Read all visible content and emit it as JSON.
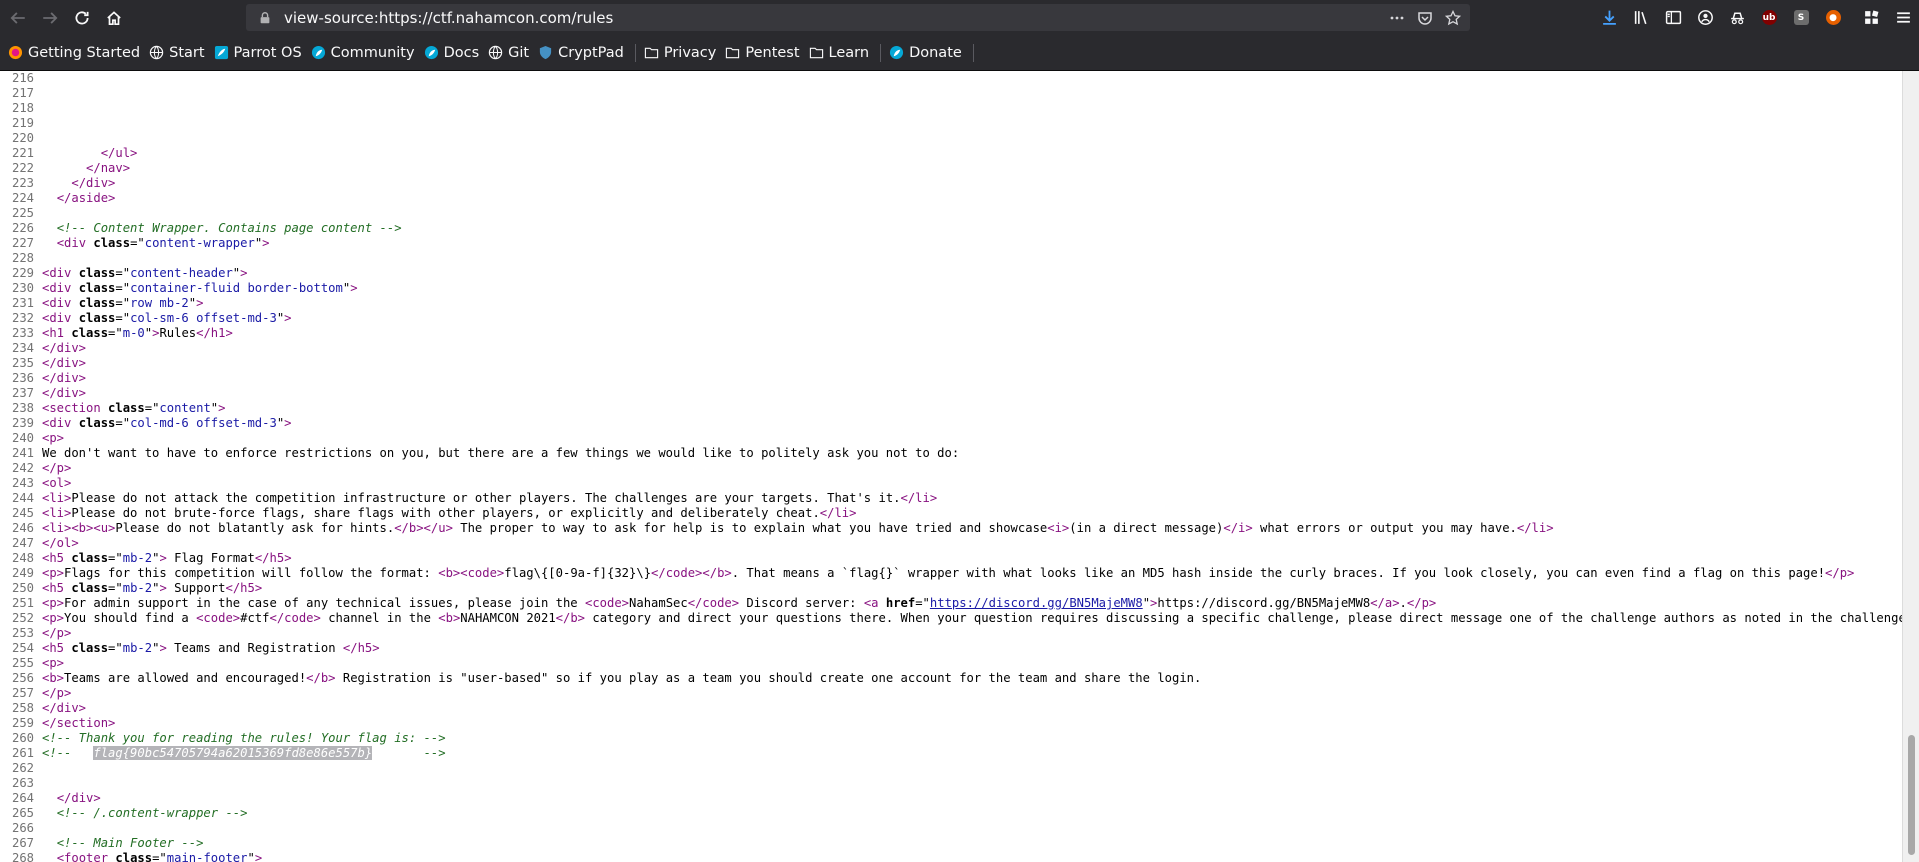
{
  "browser": {
    "url": "view-source:https://ctf.nahamcon.com/rules",
    "bookmarks": [
      {
        "label": "Getting Started",
        "icon": "firefox-icon"
      },
      {
        "label": "Start",
        "icon": "globe-icon"
      },
      {
        "label": "Parrot OS",
        "icon": "parrot-icon"
      },
      {
        "label": "Community",
        "icon": "parrot-community-icon"
      },
      {
        "label": "Docs",
        "icon": "parrot-docs-icon"
      },
      {
        "label": "Git",
        "icon": "globe-icon"
      },
      {
        "label": "CryptPad",
        "icon": "cryptpad-icon"
      },
      {
        "label": "Privacy",
        "icon": "folder-icon"
      },
      {
        "label": "Pentest",
        "icon": "folder-icon"
      },
      {
        "label": "Learn",
        "icon": "folder-icon"
      },
      {
        "label": "Donate",
        "icon": "parrot-donate-icon"
      }
    ]
  },
  "source": {
    "lines": [
      {
        "n": "216",
        "segs": []
      },
      {
        "n": "217",
        "segs": []
      },
      {
        "n": "218",
        "segs": []
      },
      {
        "n": "219",
        "segs": []
      },
      {
        "n": "220",
        "segs": []
      },
      {
        "n": "221",
        "segs": [
          {
            "t": "        "
          },
          {
            "c": "tag",
            "t": "</ul>"
          }
        ]
      },
      {
        "n": "222",
        "segs": [
          {
            "t": "      "
          },
          {
            "c": "tag",
            "t": "</nav>"
          }
        ]
      },
      {
        "n": "223",
        "segs": [
          {
            "t": "    "
          },
          {
            "c": "tag",
            "t": "</div>"
          }
        ]
      },
      {
        "n": "224",
        "segs": [
          {
            "t": "  "
          },
          {
            "c": "tag",
            "t": "</aside>"
          }
        ]
      },
      {
        "n": "225",
        "segs": []
      },
      {
        "n": "226",
        "segs": [
          {
            "t": "  "
          },
          {
            "c": "comment",
            "t": "<!-- Content Wrapper. Contains page content -->"
          }
        ]
      },
      {
        "n": "227",
        "segs": [
          {
            "t": "  "
          },
          {
            "c": "tag",
            "t": "<div "
          },
          {
            "c": "attr",
            "t": "class"
          },
          {
            "t": "=\""
          },
          {
            "c": "val",
            "t": "content-wrapper"
          },
          {
            "t": "\""
          },
          {
            "c": "tag",
            "t": ">"
          }
        ]
      },
      {
        "n": "228",
        "segs": []
      },
      {
        "n": "229",
        "segs": [
          {
            "c": "tag",
            "t": "<div "
          },
          {
            "c": "attr",
            "t": "class"
          },
          {
            "t": "=\""
          },
          {
            "c": "val",
            "t": "content-header"
          },
          {
            "t": "\""
          },
          {
            "c": "tag",
            "t": ">"
          }
        ]
      },
      {
        "n": "230",
        "segs": [
          {
            "c": "tag",
            "t": "<div "
          },
          {
            "c": "attr",
            "t": "class"
          },
          {
            "t": "=\""
          },
          {
            "c": "val",
            "t": "container-fluid border-bottom"
          },
          {
            "t": "\""
          },
          {
            "c": "tag",
            "t": ">"
          }
        ]
      },
      {
        "n": "231",
        "segs": [
          {
            "c": "tag",
            "t": "<div "
          },
          {
            "c": "attr",
            "t": "class"
          },
          {
            "t": "=\""
          },
          {
            "c": "val",
            "t": "row mb-2"
          },
          {
            "t": "\""
          },
          {
            "c": "tag",
            "t": ">"
          }
        ]
      },
      {
        "n": "232",
        "segs": [
          {
            "c": "tag",
            "t": "<div "
          },
          {
            "c": "attr",
            "t": "class"
          },
          {
            "t": "=\""
          },
          {
            "c": "val",
            "t": "col-sm-6 offset-md-3"
          },
          {
            "t": "\""
          },
          {
            "c": "tag",
            "t": ">"
          }
        ]
      },
      {
        "n": "233",
        "segs": [
          {
            "c": "tag",
            "t": "<h1 "
          },
          {
            "c": "attr",
            "t": "class"
          },
          {
            "t": "=\""
          },
          {
            "c": "val",
            "t": "m-0"
          },
          {
            "t": "\""
          },
          {
            "c": "tag",
            "t": ">"
          },
          {
            "t": "Rules"
          },
          {
            "c": "tag",
            "t": "</h1>"
          }
        ]
      },
      {
        "n": "234",
        "segs": [
          {
            "c": "tag",
            "t": "</div>"
          }
        ]
      },
      {
        "n": "235",
        "segs": [
          {
            "c": "tag",
            "t": "</div>"
          }
        ]
      },
      {
        "n": "236",
        "segs": [
          {
            "c": "tag",
            "t": "</div>"
          }
        ]
      },
      {
        "n": "237",
        "segs": [
          {
            "c": "tag",
            "t": "</div>"
          }
        ]
      },
      {
        "n": "238",
        "segs": [
          {
            "c": "tag",
            "t": "<section "
          },
          {
            "c": "attr",
            "t": "class"
          },
          {
            "t": "=\""
          },
          {
            "c": "val",
            "t": "content"
          },
          {
            "t": "\""
          },
          {
            "c": "tag",
            "t": ">"
          }
        ]
      },
      {
        "n": "239",
        "segs": [
          {
            "c": "tag",
            "t": "<div "
          },
          {
            "c": "attr",
            "t": "class"
          },
          {
            "t": "=\""
          },
          {
            "c": "val",
            "t": "col-md-6 offset-md-3"
          },
          {
            "t": "\""
          },
          {
            "c": "tag",
            "t": ">"
          }
        ]
      },
      {
        "n": "240",
        "segs": [
          {
            "c": "tag",
            "t": "<p>"
          }
        ]
      },
      {
        "n": "241",
        "segs": [
          {
            "t": "We don't want to have to enforce restrictions on you, but there are a few things we would like to politely ask you not to do:"
          }
        ]
      },
      {
        "n": "242",
        "segs": [
          {
            "c": "tag",
            "t": "</p>"
          }
        ]
      },
      {
        "n": "243",
        "segs": [
          {
            "c": "tag",
            "t": "<ol>"
          }
        ]
      },
      {
        "n": "244",
        "segs": [
          {
            "c": "tag",
            "t": "<li>"
          },
          {
            "t": "Please do not attack the competition infrastructure or other players. The challenges are your targets. That's it."
          },
          {
            "c": "tag",
            "t": "</li>"
          }
        ]
      },
      {
        "n": "245",
        "segs": [
          {
            "c": "tag",
            "t": "<li>"
          },
          {
            "t": "Please do not brute-force flags, share flags with other players, or explicitly and deliberately cheat."
          },
          {
            "c": "tag",
            "t": "</li>"
          }
        ]
      },
      {
        "n": "246",
        "segs": [
          {
            "c": "tag",
            "t": "<li><b><u>"
          },
          {
            "t": "Please do not blatantly ask for hints."
          },
          {
            "c": "tag",
            "t": "</b></u>"
          },
          {
            "t": " The proper to way to ask for help is to explain what you have tried and showcase"
          },
          {
            "c": "tag",
            "t": "<i>"
          },
          {
            "t": "(in a direct message)"
          },
          {
            "c": "tag",
            "t": "</i>"
          },
          {
            "t": " what errors or output you may have."
          },
          {
            "c": "tag",
            "t": "</li>"
          }
        ]
      },
      {
        "n": "247",
        "segs": [
          {
            "c": "tag",
            "t": "</ol>"
          }
        ]
      },
      {
        "n": "248",
        "segs": [
          {
            "c": "tag",
            "t": "<h5 "
          },
          {
            "c": "attr",
            "t": "class"
          },
          {
            "t": "=\""
          },
          {
            "c": "val",
            "t": "mb-2"
          },
          {
            "t": "\""
          },
          {
            "c": "tag",
            "t": ">"
          },
          {
            "t": " Flag Format"
          },
          {
            "c": "tag",
            "t": "</h5>"
          }
        ]
      },
      {
        "n": "249",
        "segs": [
          {
            "c": "tag",
            "t": "<p>"
          },
          {
            "t": "Flags for this competition will follow the format: "
          },
          {
            "c": "tag",
            "t": "<b><code>"
          },
          {
            "t": "flag\\{[0-9a-f]{32}\\}"
          },
          {
            "c": "tag",
            "t": "</code></b>"
          },
          {
            "t": ". That means a `flag{}` wrapper with what looks like an MD5 hash inside the curly braces. If you look closely, you can even find a flag on this page!"
          },
          {
            "c": "tag",
            "t": "</p>"
          }
        ]
      },
      {
        "n": "250",
        "segs": [
          {
            "c": "tag",
            "t": "<h5 "
          },
          {
            "c": "attr",
            "t": "class"
          },
          {
            "t": "=\""
          },
          {
            "c": "val",
            "t": "mb-2"
          },
          {
            "t": "\""
          },
          {
            "c": "tag",
            "t": ">"
          },
          {
            "t": " Support"
          },
          {
            "c": "tag",
            "t": "</h5>"
          }
        ]
      },
      {
        "n": "251",
        "segs": [
          {
            "c": "tag",
            "t": "<p>"
          },
          {
            "t": "For admin support in the case of any technical issues, please join the "
          },
          {
            "c": "tag",
            "t": "<code>"
          },
          {
            "t": "NahamSec"
          },
          {
            "c": "tag",
            "t": "</code>"
          },
          {
            "t": " Discord server: "
          },
          {
            "c": "tag",
            "t": "<a "
          },
          {
            "c": "attr",
            "t": "href"
          },
          {
            "t": "=\""
          },
          {
            "c": "link",
            "t": "https://discord.gg/BN5MajeMW8"
          },
          {
            "t": "\""
          },
          {
            "c": "tag",
            "t": ">"
          },
          {
            "t": "https://discord.gg/BN5MajeMW8"
          },
          {
            "c": "tag",
            "t": "</a>"
          },
          {
            "t": "."
          },
          {
            "c": "tag",
            "t": "</p>"
          }
        ]
      },
      {
        "n": "252",
        "segs": [
          {
            "c": "tag",
            "t": "<p>"
          },
          {
            "t": "You should find a "
          },
          {
            "c": "tag",
            "t": "<code>"
          },
          {
            "t": "#ctf"
          },
          {
            "c": "tag",
            "t": "</code>"
          },
          {
            "t": " channel in the "
          },
          {
            "c": "tag",
            "t": "<b>"
          },
          {
            "t": "NAHAMCON 2021"
          },
          {
            "c": "tag",
            "t": "</b>"
          },
          {
            "t": " category and direct your questions there. When your question requires discussing a specific challenge, please direct message one of the challenge authors as noted in the challenge desc"
          }
        ]
      },
      {
        "n": "253",
        "segs": [
          {
            "c": "tag",
            "t": "</p>"
          }
        ]
      },
      {
        "n": "254",
        "segs": [
          {
            "c": "tag",
            "t": "<h5 "
          },
          {
            "c": "attr",
            "t": "class"
          },
          {
            "t": "=\""
          },
          {
            "c": "val",
            "t": "mb-2"
          },
          {
            "t": "\""
          },
          {
            "c": "tag",
            "t": ">"
          },
          {
            "t": " Teams and Registration "
          },
          {
            "c": "tag",
            "t": "</h5>"
          }
        ]
      },
      {
        "n": "255",
        "segs": [
          {
            "c": "tag",
            "t": "<p>"
          }
        ]
      },
      {
        "n": "256",
        "segs": [
          {
            "c": "tag",
            "t": "<b>"
          },
          {
            "t": "Teams are allowed and encouraged!"
          },
          {
            "c": "tag",
            "t": "</b>"
          },
          {
            "t": " Registration is \"user-based\" so if you play as a team you should create one account for the team and share the login."
          }
        ]
      },
      {
        "n": "257",
        "segs": [
          {
            "c": "tag",
            "t": "</p>"
          }
        ]
      },
      {
        "n": "258",
        "segs": [
          {
            "c": "tag",
            "t": "</div>"
          }
        ]
      },
      {
        "n": "259",
        "segs": [
          {
            "c": "tag",
            "t": "</section>"
          }
        ]
      },
      {
        "n": "260",
        "segs": [
          {
            "c": "comment",
            "t": "<!-- Thank you for reading the rules! Your flag is: -->"
          }
        ]
      },
      {
        "n": "261",
        "segs": [
          {
            "c": "comment",
            "t": "<!--   "
          },
          {
            "c": "sel",
            "t": "flag{90bc54705794a62015369fd8e86e557b}"
          },
          {
            "c": "comment",
            "t": "       -->"
          }
        ]
      },
      {
        "n": "262",
        "segs": []
      },
      {
        "n": "263",
        "segs": []
      },
      {
        "n": "264",
        "segs": [
          {
            "t": "  "
          },
          {
            "c": "tag",
            "t": "</div>"
          }
        ]
      },
      {
        "n": "265",
        "segs": [
          {
            "t": "  "
          },
          {
            "c": "comment",
            "t": "<!-- /.content-wrapper -->"
          }
        ]
      },
      {
        "n": "266",
        "segs": []
      },
      {
        "n": "267",
        "segs": [
          {
            "t": "  "
          },
          {
            "c": "comment",
            "t": "<!-- Main Footer -->"
          }
        ]
      },
      {
        "n": "268",
        "segs": [
          {
            "t": "  "
          },
          {
            "c": "tag",
            "t": "<footer "
          },
          {
            "c": "attr",
            "t": "class"
          },
          {
            "t": "=\""
          },
          {
            "c": "val",
            "t": "main-footer"
          },
          {
            "t": "\""
          },
          {
            "c": "tag",
            "t": ">"
          }
        ]
      }
    ]
  }
}
